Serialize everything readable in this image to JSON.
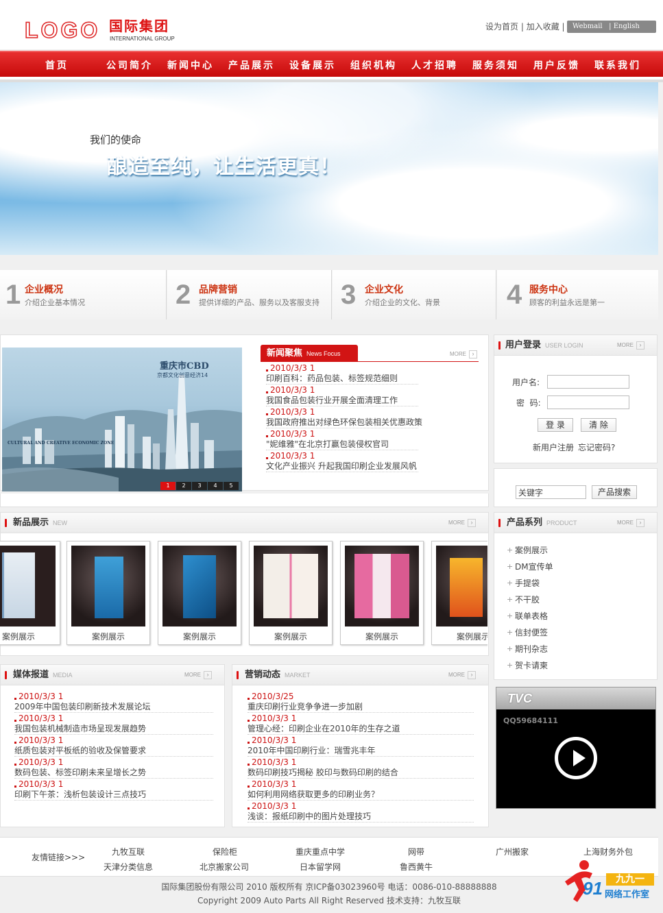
{
  "header": {
    "logo_word": "LOGO",
    "logo_cn": "国际集团",
    "logo_en": "INTERNATIONAL GROUP",
    "links": [
      "设为首页",
      "加入收藏"
    ],
    "lang": [
      "Webmail",
      "English"
    ]
  },
  "nav": [
    "首页",
    "公司简介",
    "新闻中心",
    "产品展示",
    "设备展示",
    "组织机构",
    "人才招聘",
    "服务须知",
    "用户反馈",
    "联系我们"
  ],
  "banner": {
    "small": "我们的使命",
    "big": "酿造至纯，让生活更真！"
  },
  "features": [
    {
      "num": "1",
      "title": "企业概况",
      "sub": "介绍企业基本情况"
    },
    {
      "num": "2",
      "title": "品牌营销",
      "sub": "提供详细的产品、服务以及客服支持"
    },
    {
      "num": "3",
      "title": "企业文化",
      "sub": "介绍企业的文化、背景"
    },
    {
      "num": "4",
      "title": "服务中心",
      "sub": "顾客的利益永远是第一"
    }
  ],
  "focus": {
    "img_title": "重庆市CBD",
    "img_sub": "京都文化创意经济14",
    "img_en": "CULTURAL AND CREATIVE ECONOMIC ZONE",
    "pages": [
      "1",
      "2",
      "3",
      "4",
      "5"
    ]
  },
  "news_focus": {
    "title": "新闻聚焦",
    "en": "News Focus",
    "more": "MORE",
    "items": [
      {
        "date": "2010/3/3 1",
        "title": "印刷百科：药品包装、标签规范细则"
      },
      {
        "date": "2010/3/3 1",
        "title": "我国食品包装行业开展全面清理工作"
      },
      {
        "date": "2010/3/3 1",
        "title": "我国政府推出对绿色环保包装相关优惠政策"
      },
      {
        "date": "2010/3/3 1",
        "title": "\"妮维雅\"在北京打赢包装侵权官司"
      },
      {
        "date": "2010/3/3 1",
        "title": "文化产业振兴 升起我国印刷企业发展风帆"
      }
    ]
  },
  "login": {
    "title": "用户登录",
    "en": "USER LOGIN",
    "more": "MORE",
    "user_label": "用户名:",
    "pass_label": "密  码:",
    "login_btn": "登 录",
    "clear_btn": "清 除",
    "register": "新用户注册",
    "forgot": "忘记密码?"
  },
  "search": {
    "value": "关键字",
    "button": "产品搜索"
  },
  "new_products": {
    "title": "新品展示",
    "en": "NEW",
    "more": "MORE",
    "items": [
      "案例展示",
      "案例展示",
      "案例展示",
      "案例展示",
      "案例展示",
      "案例展示"
    ]
  },
  "product_series": {
    "title": "产品系列",
    "en": "PRODUCT",
    "more": "MORE",
    "items": [
      "案例展示",
      "DM宣传单",
      "手提袋",
      "不干胶",
      "联单表格",
      "信封便签",
      "期刊杂志",
      "贺卡请柬"
    ]
  },
  "media": {
    "title": "媒体报道",
    "en": "MEDIA",
    "more": "MORE",
    "items": [
      {
        "date": "2010/3/3 1",
        "title": "2009年中国包装印刷新技术发展论坛"
      },
      {
        "date": "2010/3/3 1",
        "title": "我国包装机械制造市场呈现发展趋势"
      },
      {
        "date": "2010/3/3 1",
        "title": "纸质包装对平板纸的验收及保管要求"
      },
      {
        "date": "2010/3/3 1",
        "title": "数码包装、标签印刷未来呈增长之势"
      },
      {
        "date": "2010/3/3 1",
        "title": "印刷下午茶：浅析包装设计三点技巧"
      }
    ]
  },
  "market": {
    "title": "营销动态",
    "en": "MARKET",
    "more": "MORE",
    "items": [
      {
        "date": "2010/3/25",
        "title": "重庆印刷行业竞争争进一步加剧"
      },
      {
        "date": "2010/3/3 1",
        "title": "管理心经：印刷企业在2010年的生存之道"
      },
      {
        "date": "2010/3/3 1",
        "title": "2010年中国印刷行业：瑞雪兆丰年"
      },
      {
        "date": "2010/3/3 1",
        "title": "数码印刷技巧揭秘 胶印与数码印刷的结合"
      },
      {
        "date": "2010/3/3 1",
        "title": "如何利用网络获取更多的印刷业务？"
      },
      {
        "date": "2010/3/3 1",
        "title": "浅谈：报纸印刷中的图片处理技巧"
      }
    ]
  },
  "tvc": {
    "title": "TVC",
    "qq": "QQ59684111"
  },
  "footer": {
    "label": "友情链接>>>",
    "links_row1": [
      "九牧互联",
      "保险柜",
      "重庆重点中学",
      "网带",
      "广州搬家",
      "上海财务外包"
    ],
    "links_row2": [
      "天津分类信息",
      "北京搬家公司",
      "日本留学网",
      "鲁西黄牛"
    ],
    "copyright1": "国际集团股份有限公司 2010 版权所有 京ICP备03023960号 电话：0086-010-88888888",
    "copyright2": "Copyright 2009 Auto Parts All Right Reserved 技术支持：九牧互联"
  },
  "watermark": {
    "num": "91",
    "cn1": "九九一",
    "cn2": "网络工作室"
  }
}
